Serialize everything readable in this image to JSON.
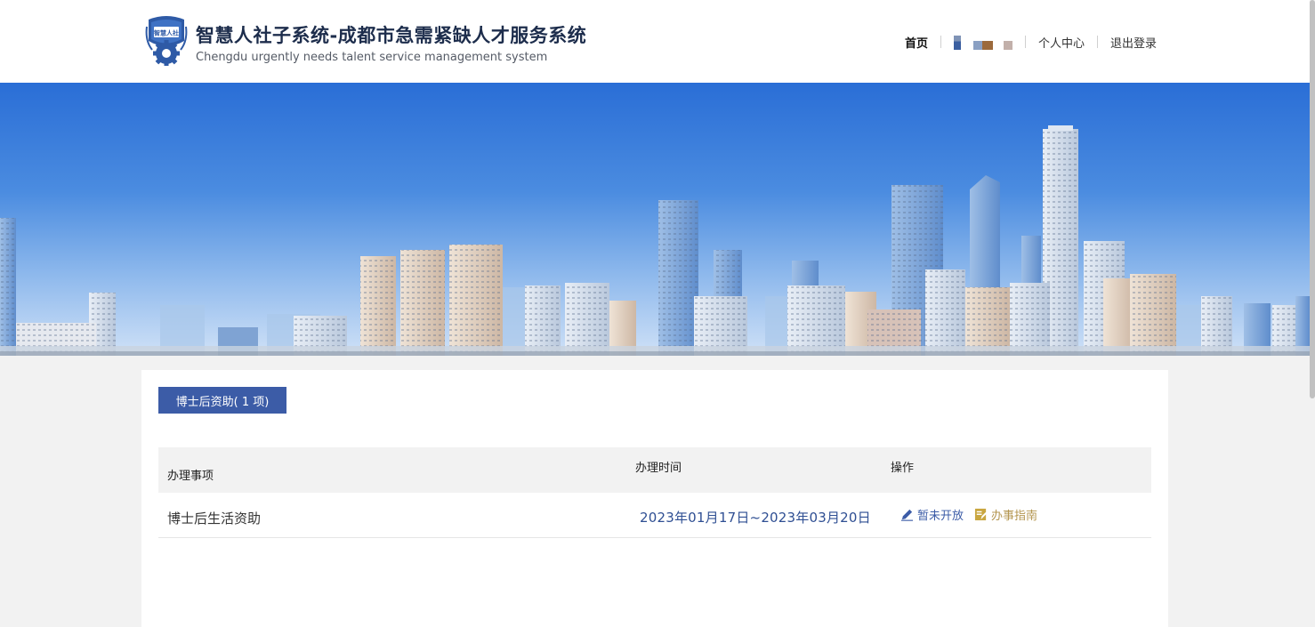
{
  "header": {
    "title": "智慧人社子系统-成都市急需紧缺人才服务系统",
    "subtitle": "Chengdu urgently needs talent service management system",
    "logo_text": "智慧人社",
    "nav": {
      "home": "首页",
      "personal_center": "个人中心",
      "logout": "退出登录"
    }
  },
  "main": {
    "category_tab": "博士后资助( 1 项)",
    "table": {
      "columns": {
        "item": "办理事项",
        "time": "办理时间",
        "actions": "操作"
      },
      "rows": [
        {
          "item": "博士后生活资助",
          "time": "2023年01月17日~2023年03月20日",
          "status_action": "暂未开放",
          "guide_action": "办事指南"
        }
      ]
    }
  },
  "colors": {
    "brand_blue": "#3c5ca7",
    "guide_gold": "#b49650",
    "time_text": "#2f4f93"
  },
  "icons": [
    "logo-gear-icon",
    "edit-pencil-icon",
    "guide-document-icon"
  ]
}
